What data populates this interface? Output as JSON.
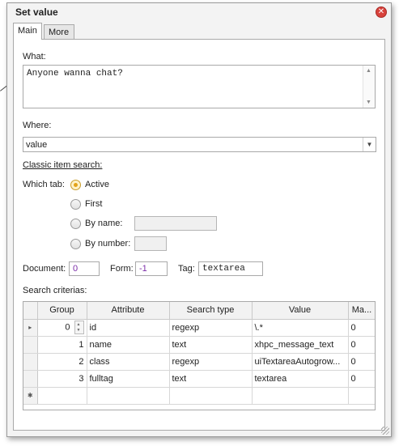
{
  "dialog": {
    "title": "Set value",
    "close_symbol": "✕"
  },
  "tabs": [
    {
      "label": "Main",
      "active": true
    },
    {
      "label": "More",
      "active": false
    }
  ],
  "what": {
    "label": "What:",
    "value": "Anyone wanna chat?"
  },
  "where": {
    "label": "Where:",
    "value": "value"
  },
  "classic_search": {
    "label": "Classic item search:",
    "which_tab_label": "Which tab:",
    "options": [
      {
        "label": "Active",
        "checked": true
      },
      {
        "label": "First",
        "checked": false
      },
      {
        "label": "By name:",
        "checked": false
      },
      {
        "label": "By number:",
        "checked": false
      }
    ]
  },
  "document": {
    "label": "Document:",
    "value": "0"
  },
  "form": {
    "label": "Form:",
    "value": "-1"
  },
  "tag": {
    "label": "Tag:",
    "value": "textarea"
  },
  "criteria": {
    "label": "Search criterias:",
    "columns": [
      "Group",
      "Attribute",
      "Search type",
      "Value",
      "Ma..."
    ],
    "rows": [
      {
        "group": "0",
        "attribute": "id",
        "search_type": "regexp",
        "value": "\\.*",
        "match": "0"
      },
      {
        "group": "1",
        "attribute": "name",
        "search_type": "text",
        "value": "xhpc_message_text",
        "match": "0"
      },
      {
        "group": "2",
        "attribute": "class",
        "search_type": "regexp",
        "value": "uiTextareaAutogrow...",
        "match": "0"
      },
      {
        "group": "3",
        "attribute": "fulltag",
        "search_type": "text",
        "value": "textarea",
        "match": "0"
      }
    ],
    "current_row_marker": "▸",
    "new_row_marker": "✱"
  },
  "colors": {
    "accent_radio": "#e3a319",
    "close_button": "#d8423c",
    "input_value_purple": "#7c2ca8"
  }
}
